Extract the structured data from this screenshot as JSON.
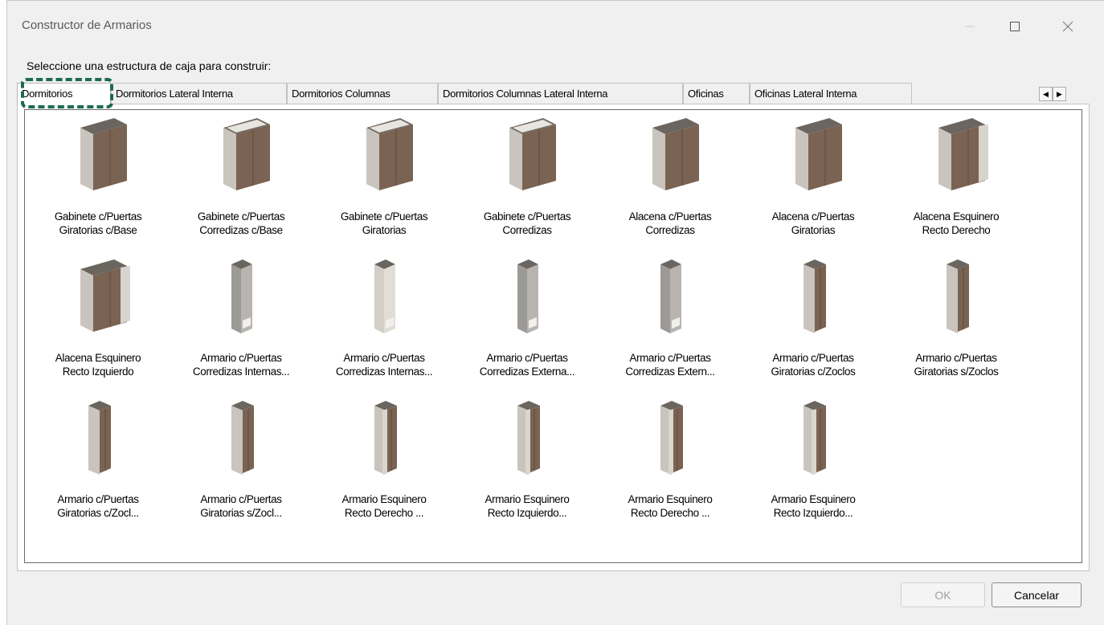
{
  "window": {
    "title": "Constructor de Armarios",
    "controls": [
      "minimize-icon",
      "maximize-icon",
      "close-icon"
    ]
  },
  "prompt": "Seleccione una estructura de caja para construir:",
  "tabs": [
    {
      "label": "Dormitorios",
      "active": true
    },
    {
      "label": "Dormitorios Lateral Interna",
      "active": false
    },
    {
      "label": "Dormitorios Columnas",
      "active": false
    },
    {
      "label": "Dormitorios Columnas Lateral Interna",
      "active": false
    },
    {
      "label": "Oficinas",
      "active": false
    },
    {
      "label": "Oficinas Lateral Interna",
      "active": false
    }
  ],
  "colors": {
    "wood": "#7a6352",
    "wood_dark": "#5e4a3d",
    "panel": "#c9c4bd",
    "panel_side": "#a8a39c",
    "panel_top": "#6b6560",
    "focus": "#1a6b50"
  },
  "items": [
    {
      "line1": "Gabinete c/Puertas",
      "line2": "Giratorias c/Base",
      "icon": "wide-cabinet-icon"
    },
    {
      "line1": "Gabinete c/Puertas",
      "line2": "Corredizas c/Base",
      "icon": "wide-cabinet-open-top-icon"
    },
    {
      "line1": "Gabinete c/Puertas",
      "line2": "Giratorias",
      "icon": "wide-cabinet-open-top-icon"
    },
    {
      "line1": "Gabinete c/Puertas",
      "line2": "Corredizas",
      "icon": "wide-cabinet-open-top-icon"
    },
    {
      "line1": "Alacena c/Puertas",
      "line2": "Corredizas",
      "icon": "wide-cabinet-icon"
    },
    {
      "line1": "Alacena c/Puertas",
      "line2": "Giratorias",
      "icon": "wide-cabinet-icon"
    },
    {
      "line1": "Alacena Esquinero",
      "line2": "Recto Derecho",
      "icon": "corner-cabinet-icon"
    },
    {
      "line1": "Alacena Esquinero",
      "line2": "Recto Izquierdo",
      "icon": "corner-cabinet-icon"
    },
    {
      "line1": "Armario c/Puertas",
      "line2": "Corredizas Internas...",
      "icon": "tall-frame-grey-icon"
    },
    {
      "line1": "Armario c/Puertas",
      "line2": "Corredizas Internas...",
      "icon": "tall-frame-light-icon"
    },
    {
      "line1": "Armario c/Puertas",
      "line2": "Corredizas Externa...",
      "icon": "tall-frame-grey-icon"
    },
    {
      "line1": "Armario c/Puertas",
      "line2": "Corredizas Extern...",
      "icon": "tall-frame-grey-icon"
    },
    {
      "line1": "Armario c/Puertas",
      "line2": "Giratorias c/Zoclos",
      "icon": "tall-wardrobe-icon"
    },
    {
      "line1": "Armario c/Puertas",
      "line2": "Giratorias s/Zoclos",
      "icon": "tall-wardrobe-icon"
    },
    {
      "line1": "Armario c/Puertas",
      "line2": "Giratorias c/Zocl...",
      "icon": "tall-wardrobe-icon"
    },
    {
      "line1": "Armario c/Puertas",
      "line2": "Giratorias s/Zocl...",
      "icon": "tall-wardrobe-icon"
    },
    {
      "line1": "Armario Esquinero",
      "line2": "Recto Derecho ...",
      "icon": "tall-corner-wardrobe-icon"
    },
    {
      "line1": "Armario Esquinero",
      "line2": "Recto Izquierdo...",
      "icon": "tall-corner-wardrobe-icon"
    },
    {
      "line1": "Armario Esquinero",
      "line2": "Recto Derecho ...",
      "icon": "tall-corner-wardrobe-icon"
    },
    {
      "line1": "Armario Esquinero",
      "line2": "Recto Izquierdo...",
      "icon": "tall-corner-wardrobe-icon"
    }
  ],
  "buttons": {
    "ok": "OK",
    "cancel": "Cancelar",
    "ok_enabled": false
  }
}
